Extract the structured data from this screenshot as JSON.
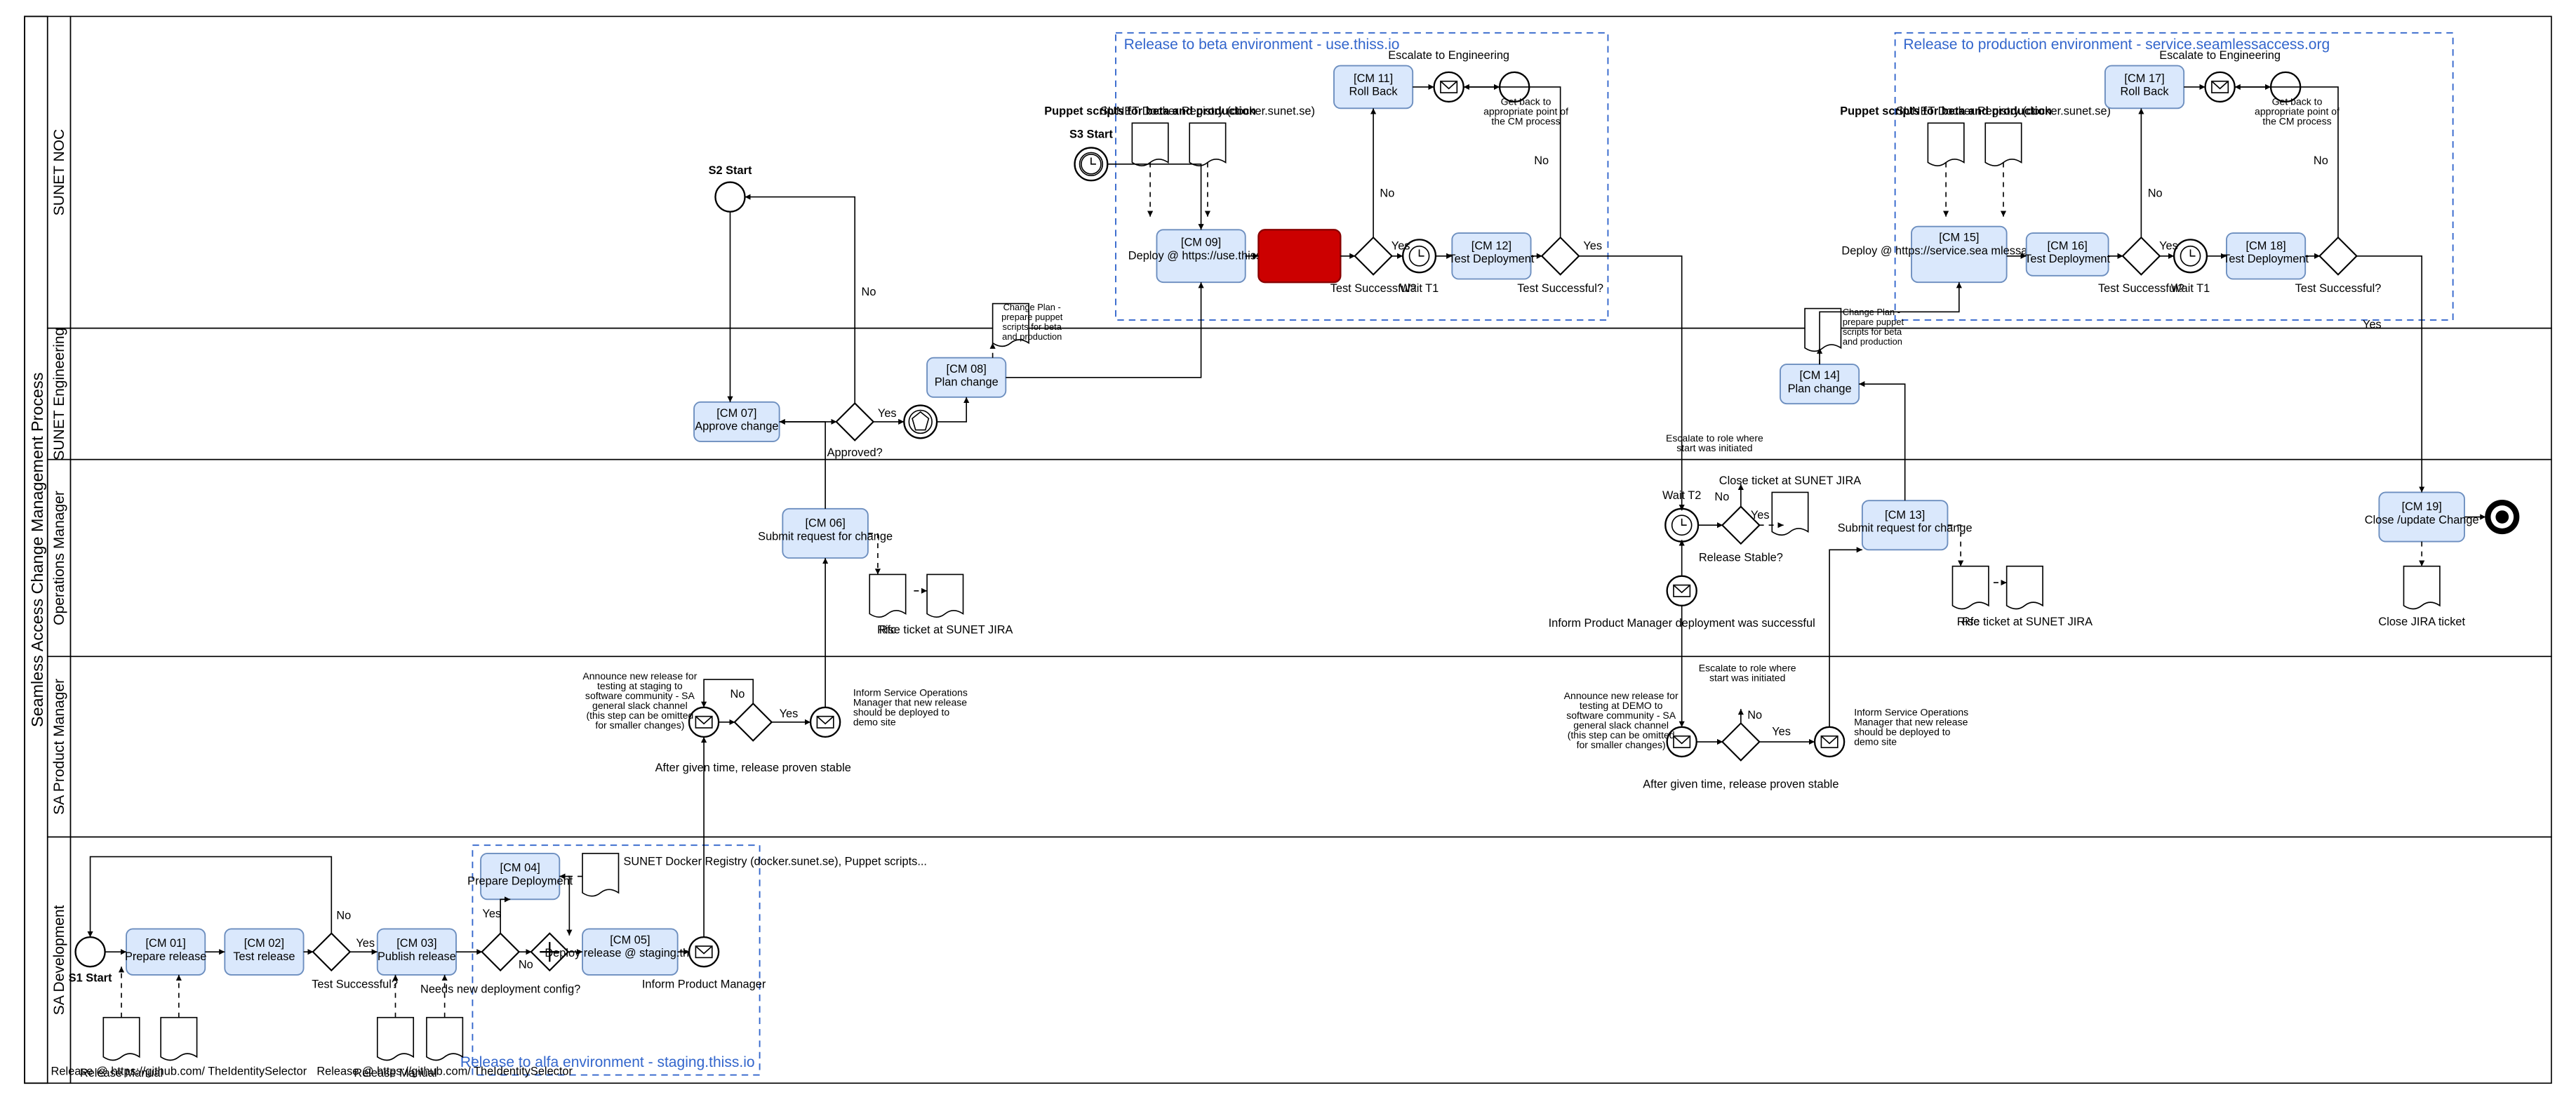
{
  "pool": "Seamless Access Change Management Process",
  "lanes": [
    "SUNET NOC",
    "SUNET Engineering",
    "Operations Manager",
    "SA  Product Manager",
    "SA Development"
  ],
  "groups": {
    "alfa": "Release to alfa environment - staging.thiss.io",
    "beta": "Release to beta environment - use.thiss.io",
    "prod": "Release to production environment - service.seamlessaccess.org"
  },
  "tasks": {
    "cm01": {
      "id": "[CM 01]",
      "t": "Prepare release"
    },
    "cm02": {
      "id": "[CM 02]",
      "t": "Test release"
    },
    "cm03": {
      "id": "[CM 03]",
      "t": "Publish release"
    },
    "cm04": {
      "id": "[CM 04]",
      "t": "Prepare Deployment"
    },
    "cm05": {
      "id": "[CM 05]",
      "t": "Deploy release @ staging.thiss.io"
    },
    "cm06": {
      "id": "[CM 06]",
      "t": "Submit request for change"
    },
    "cm07": {
      "id": "[CM 07]",
      "t": "Approve change"
    },
    "cm08": {
      "id": "[CM 08]",
      "t": "Plan change"
    },
    "cm09": {
      "id": "[CM 09]",
      "t": "Deploy @ https://use.thiss.io"
    },
    "cm11": {
      "id": "[CM 11]",
      "t": "Roll Back"
    },
    "cm12": {
      "id": "[CM 12]",
      "t": "Test Deployment"
    },
    "cm13": {
      "id": "[CM 13]",
      "t": "Submit request for change"
    },
    "cm14": {
      "id": "[CM 14]",
      "t": "Plan change"
    },
    "cm15": {
      "id": "[CM 15]",
      "t": "Deploy @ https://service.sea mlessaccess.org"
    },
    "cm16": {
      "id": "[CM 16]",
      "t": "Test Deployment"
    },
    "cm17": {
      "id": "[CM 17]",
      "t": "Roll Back"
    },
    "cm18": {
      "id": "[CM 18]",
      "t": "Test Deployment"
    },
    "cm19": {
      "id": "[CM 19]",
      "t": "Close /update Change"
    }
  },
  "gatelab": {
    "test": "Test Successful?",
    "approved": "Approved?",
    "needsdep": "Needs new deployment config?",
    "relstable": "Release Stable?",
    "wait1": "Wait T1",
    "wait2": "Wait T2",
    "proven": "After given time, release proven stable"
  },
  "starts": {
    "s1": "S1 Start",
    "s2": "S2 Start",
    "s3": "S3 Start"
  },
  "docs": {
    "relman": "Release Manual",
    "relgh": "Release @ https://github.com/ TheIdentitySelector",
    "sunetreg": "SUNET Docker Registry (docker.sunet.se), Puppet scripts...",
    "rfc": "Rfc",
    "jira": "Rise ticket at SUNET JIRA",
    "puppet": "Puppet scripts for beta and production",
    "sunetreg2": "SUNET Docker Registry (docker.sunet.se)",
    "changeplan": "Change Plan - prepare puppet scripts for beta and production",
    "closejira": "Close JIRA ticket",
    "closejira2": "Close ticket at SUNET JIRA"
  },
  "annot": {
    "inform_pm": "Inform Product Manager",
    "announce": "Announce new release for testing at staging to software community - SA general slack channel\n(this step can be omitted for smaller changes)",
    "announce2": "Announce new release for testing at DEMO to software community - SA general slack channel\n(this step can be omitted for smaller changes)",
    "inform_som": "Inform Service Operations Manager that new release should be deployed to demo site",
    "esc_eng": "Escalate to Engineering",
    "getback": "Get back to appropriate point of the CM process",
    "inform_dep": "Inform Product Manager deployment was successful",
    "esc_role": "Escalate to role where start was initiated"
  },
  "decisions": {
    "yes": "Yes",
    "no": "No"
  },
  "chart_data": {
    "type": "bpmn-diagram",
    "lanes": [
      "SUNET NOC",
      "SUNET Engineering",
      "Operations Manager",
      "SA Product Manager",
      "SA Development"
    ],
    "nodes": [
      {
        "id": "S1",
        "type": "start",
        "lane": "SA Development"
      },
      {
        "id": "CM01",
        "type": "task",
        "lane": "SA Development",
        "label": "Prepare release"
      },
      {
        "id": "CM02",
        "type": "task",
        "lane": "SA Development",
        "label": "Test release"
      },
      {
        "id": "G_test1",
        "type": "xor",
        "lane": "SA Development",
        "label": "Test Successful?"
      },
      {
        "id": "CM03",
        "type": "task",
        "lane": "SA Development",
        "label": "Publish release"
      },
      {
        "id": "G_depcfg",
        "type": "xor",
        "lane": "SA Development",
        "label": "Needs new deployment config?"
      },
      {
        "id": "CM04",
        "type": "task",
        "lane": "SA Development",
        "label": "Prepare Deployment"
      },
      {
        "id": "G_par1",
        "type": "parallel",
        "lane": "SA Development"
      },
      {
        "id": "CM05",
        "type": "task",
        "lane": "SA Development",
        "label": "Deploy release @ staging.thiss.io"
      },
      {
        "id": "M_informPM",
        "type": "message",
        "lane": "SA Development",
        "label": "Inform Product Manager"
      },
      {
        "id": "S2",
        "type": "start",
        "lane": "SUNET NOC"
      },
      {
        "id": "M_announce",
        "type": "message",
        "lane": "SA Product Manager",
        "label": "Announce new release"
      },
      {
        "id": "G_proven",
        "type": "xor",
        "lane": "SA Product Manager",
        "label": "After given time, release proven stable"
      },
      {
        "id": "M_informSOM",
        "type": "message",
        "lane": "SA Product Manager",
        "label": "Inform Service Operations Manager"
      },
      {
        "id": "CM06",
        "type": "task",
        "lane": "Operations Manager",
        "label": "Submit request for change"
      },
      {
        "id": "CM07",
        "type": "task",
        "lane": "SUNET Engineering",
        "label": "Approve change"
      },
      {
        "id": "G_appr",
        "type": "xor",
        "lane": "SUNET Engineering",
        "label": "Approved?"
      },
      {
        "id": "Ev_appr",
        "type": "event-gateway",
        "lane": "SUNET Engineering"
      },
      {
        "id": "CM08",
        "type": "task",
        "lane": "SUNET Engineering",
        "label": "Plan change"
      },
      {
        "id": "S3",
        "type": "timer-start",
        "lane": "SUNET NOC"
      },
      {
        "id": "CM09",
        "type": "task",
        "lane": "SUNET NOC",
        "label": "Deploy @ https://use.thiss.io"
      },
      {
        "id": "Err",
        "type": "error",
        "lane": "SUNET NOC"
      },
      {
        "id": "G_test2",
        "type": "xor",
        "lane": "SUNET NOC",
        "label": "Test Successful?"
      },
      {
        "id": "CM11",
        "type": "task",
        "lane": "SUNET NOC",
        "label": "Roll Back"
      },
      {
        "id": "T1",
        "type": "timer",
        "lane": "SUNET NOC",
        "label": "Wait T1"
      },
      {
        "id": "CM12",
        "type": "task",
        "lane": "SUNET NOC",
        "label": "Test Deployment"
      },
      {
        "id": "G_test3",
        "type": "xor",
        "lane": "SUNET NOC",
        "label": "Test Successful?"
      },
      {
        "id": "M_informDep",
        "type": "message",
        "lane": "Operations Manager",
        "label": "Inform PM deployment successful"
      },
      {
        "id": "T2",
        "type": "timer",
        "lane": "Operations Manager",
        "label": "Wait T2"
      },
      {
        "id": "G_stable",
        "type": "xor",
        "lane": "Operations Manager",
        "label": "Release Stable?"
      },
      {
        "id": "M_announce2",
        "type": "message",
        "lane": "SA Product Manager",
        "label": "Announce new release at DEMO"
      },
      {
        "id": "G_proven2",
        "type": "xor",
        "lane": "SA Product Manager",
        "label": "After given time, release proven stable"
      },
      {
        "id": "M_informSOM2",
        "type": "message",
        "lane": "SA Product Manager",
        "label": "Inform Service Operations Manager"
      },
      {
        "id": "CM13",
        "type": "task",
        "lane": "Operations Manager",
        "label": "Submit request for change"
      },
      {
        "id": "CM14",
        "type": "task",
        "lane": "SUNET Engineering",
        "label": "Plan change"
      },
      {
        "id": "CM15",
        "type": "task",
        "lane": "SUNET NOC",
        "label": "Deploy @ https://service.seamlessaccess.org"
      },
      {
        "id": "CM16",
        "type": "task",
        "lane": "SUNET NOC",
        "label": "Test Deployment"
      },
      {
        "id": "G_test4",
        "type": "xor",
        "lane": "SUNET NOC",
        "label": "Test Successful?"
      },
      {
        "id": "CM17",
        "type": "task",
        "lane": "SUNET NOC",
        "label": "Roll Back"
      },
      {
        "id": "T1b",
        "type": "timer",
        "lane": "SUNET NOC",
        "label": "Wait T1"
      },
      {
        "id": "CM18",
        "type": "task",
        "lane": "SUNET NOC",
        "label": "Test Deployment"
      },
      {
        "id": "G_test5",
        "type": "xor",
        "lane": "SUNET NOC",
        "label": "Test Successful?"
      },
      {
        "id": "CM19",
        "type": "task",
        "lane": "Operations Manager",
        "label": "Close /update Change"
      },
      {
        "id": "END",
        "type": "end",
        "lane": "Operations Manager"
      }
    ],
    "edges": [
      [
        "S1",
        "CM01"
      ],
      [
        "CM01",
        "CM02"
      ],
      [
        "CM02",
        "G_test1"
      ],
      [
        "G_test1",
        "CM03",
        "Yes"
      ],
      [
        "G_test1",
        "CM01",
        "No"
      ],
      [
        "CM03",
        "G_depcfg"
      ],
      [
        "G_depcfg",
        "CM04",
        "Yes"
      ],
      [
        "G_depcfg",
        "G_par1",
        "No"
      ],
      [
        "CM04",
        "G_par1"
      ],
      [
        "G_par1",
        "CM05"
      ],
      [
        "CM05",
        "M_informPM"
      ],
      [
        "M_informPM",
        "M_announce"
      ],
      [
        "S2",
        "G_appr"
      ],
      [
        "M_announce",
        "G_proven"
      ],
      [
        "G_proven",
        "M_informSOM",
        "Yes"
      ],
      [
        "G_proven",
        "M_announce",
        "No"
      ],
      [
        "M_informSOM",
        "CM06"
      ],
      [
        "CM06",
        "CM07"
      ],
      [
        "CM07",
        "G_appr"
      ],
      [
        "G_appr",
        "Ev_appr",
        "Yes"
      ],
      [
        "G_appr",
        "S2",
        "No"
      ],
      [
        "Ev_appr",
        "CM08"
      ],
      [
        "CM08",
        "CM09"
      ],
      [
        "S3",
        "CM09"
      ],
      [
        "CM09",
        "Err"
      ],
      [
        "Err",
        "G_test2"
      ],
      [
        "G_test2",
        "T1",
        "Yes"
      ],
      [
        "G_test2",
        "CM11",
        "No"
      ],
      [
        "CM11",
        "getback"
      ],
      [
        "T1",
        "CM12"
      ],
      [
        "CM12",
        "G_test3"
      ],
      [
        "G_test3",
        "M_informDep",
        "Yes"
      ],
      [
        "G_test3",
        "CM11",
        "No"
      ],
      [
        "M_informDep",
        "T2"
      ],
      [
        "T2",
        "G_stable"
      ],
      [
        "G_stable",
        "CM13",
        "Yes"
      ],
      [
        "G_stable",
        "esc_role",
        "No"
      ],
      [
        "M_announce2",
        "G_proven2"
      ],
      [
        "G_proven2",
        "M_informSOM2",
        "Yes"
      ],
      [
        "G_proven2",
        "esc_role",
        "No"
      ],
      [
        "M_informSOM2",
        "CM13"
      ],
      [
        "CM13",
        "CM14"
      ],
      [
        "CM14",
        "CM15"
      ],
      [
        "CM15",
        "CM16"
      ],
      [
        "CM16",
        "G_test4"
      ],
      [
        "G_test4",
        "T1b",
        "Yes"
      ],
      [
        "G_test4",
        "CM17",
        "No"
      ],
      [
        "T1b",
        "CM18"
      ],
      [
        "CM18",
        "G_test5"
      ],
      [
        "G_test5",
        "CM19",
        "Yes"
      ],
      [
        "G_test5",
        "CM17",
        "No"
      ],
      [
        "CM19",
        "END"
      ]
    ]
  }
}
